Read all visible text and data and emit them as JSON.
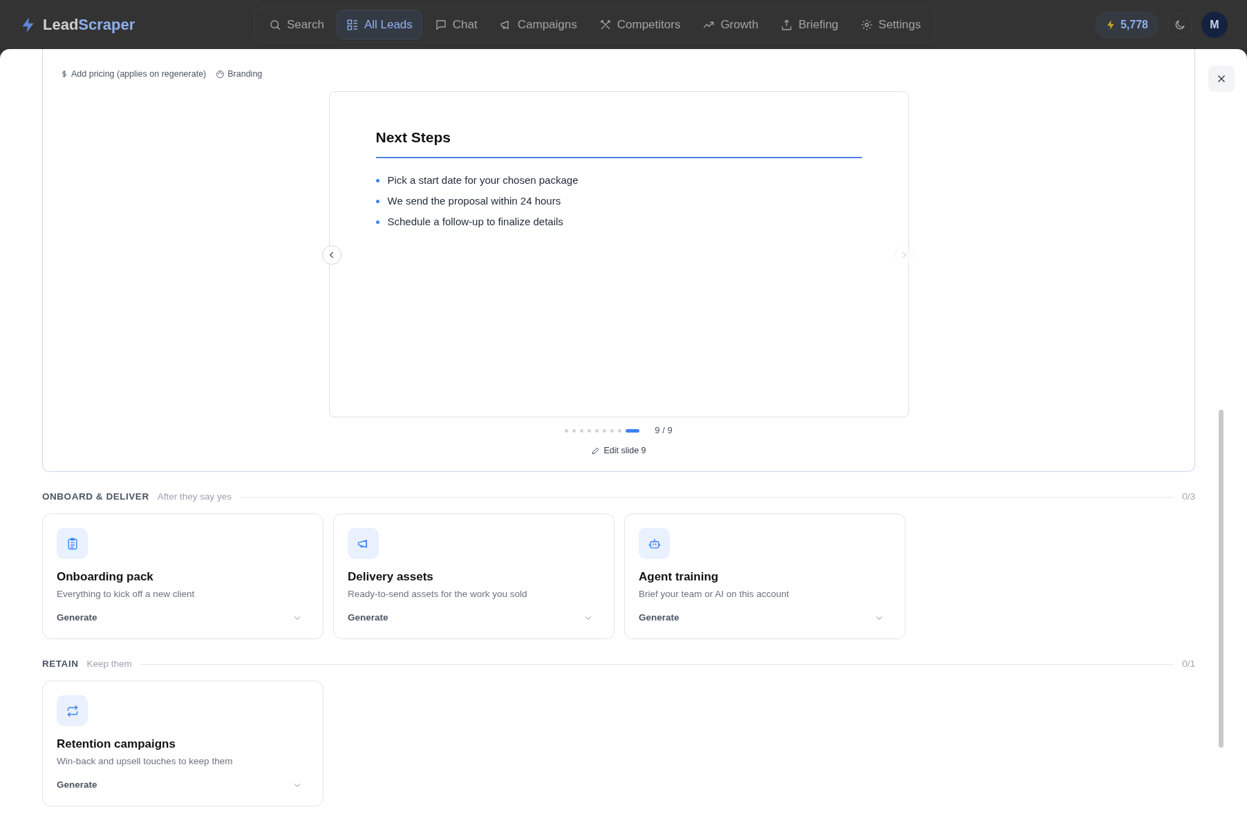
{
  "navbar": {
    "logo_first": "Lead",
    "logo_second": "Scraper",
    "items": [
      {
        "label": "Search",
        "selected": false
      },
      {
        "label": "All Leads",
        "selected": true
      },
      {
        "label": "Chat",
        "selected": false
      },
      {
        "label": "Campaigns",
        "selected": false
      },
      {
        "label": "Competitors",
        "selected": false
      },
      {
        "label": "Growth",
        "selected": false
      },
      {
        "label": "Briefing",
        "selected": false
      },
      {
        "label": "Settings",
        "selected": false
      }
    ],
    "credits": "5,778",
    "avatar": "M"
  },
  "toolbar": {
    "pricing": "Add pricing (applies on regenerate)",
    "branding": "Branding"
  },
  "slide": {
    "title": "Next Steps",
    "bullets": [
      "Pick a start date for your chosen package",
      "We send the proposal within 24 hours",
      "Schedule a follow-up to finalize details"
    ],
    "prev_disabled": false,
    "next_disabled": true,
    "dots": [
      {
        "selected": false
      },
      {
        "selected": false
      },
      {
        "selected": false
      },
      {
        "selected": false
      },
      {
        "selected": false
      },
      {
        "selected": false
      },
      {
        "selected": false
      },
      {
        "selected": false
      },
      {
        "selected": true
      }
    ],
    "counter": "9 / 9",
    "edit": "Edit slide 9"
  },
  "sections": [
    {
      "title": "ONBOARD & DELIVER",
      "subtitle": "After they say yes",
      "count": "0/3",
      "cards": [
        {
          "title": "Onboarding pack",
          "description": "Everything to kick off a new client",
          "action": "Generate"
        },
        {
          "title": "Delivery assets",
          "description": "Ready-to-send assets for the work you sold",
          "action": "Generate"
        },
        {
          "title": "Agent training",
          "description": "Brief your team or AI on this account",
          "action": "Generate"
        }
      ]
    },
    {
      "title": "RETAIN",
      "subtitle": "Keep them",
      "count": "0/1",
      "cards": [
        {
          "title": "Retention campaigns",
          "description": "Win-back and upsell touches to keep them",
          "action": "Generate"
        }
      ]
    }
  ]
}
